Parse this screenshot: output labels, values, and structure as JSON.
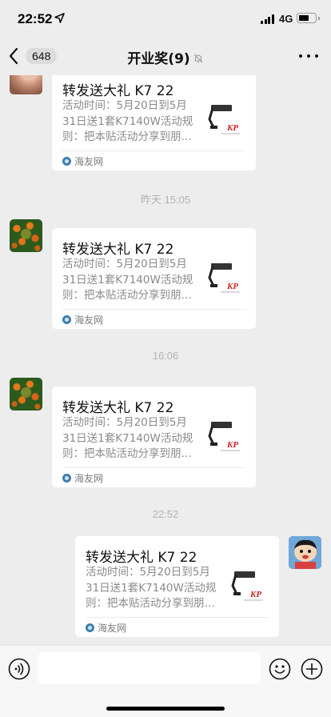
{
  "status_bar": {
    "time": "22:52",
    "network": "4G",
    "icons": [
      "location-arrow-icon",
      "signal-icon",
      "battery-icon"
    ]
  },
  "nav": {
    "unread_count": "648",
    "title": "开业奖(9)",
    "icons": [
      "back-chevron-icon",
      "mute-bell-icon",
      "more-icon"
    ]
  },
  "messages": {
    "timestamps": [
      "昨天 15:05",
      "16:06",
      "22:52"
    ],
    "cards": [
      {
        "sender": "other",
        "title": "转发送大礼 K7 22",
        "desc": "活动时间：5月20日到5月31日送1套K7140W活动规则：把本贴活动分享到朋友圈",
        "source": "海友网"
      },
      {
        "sender": "other",
        "title": "转发送大礼 K7 22",
        "desc": "活动时间：5月20日到5月31日送1套K7140W活动规则：把本贴活动分享到朋友圈",
        "source": "海友网"
      },
      {
        "sender": "other",
        "title": "转发送大礼 K7 22",
        "desc": "活动时间：5月20日到5月31日送1套K7140W活动规则：把本贴活动分享到朋友圈",
        "source": "海友网"
      },
      {
        "sender": "self",
        "title": "转发送大礼 K7 22",
        "desc": "活动时间：5月20日到5月31日送1套K7140W活动规则：把本贴活动分享到朋友圈",
        "source": "海友网"
      }
    ]
  },
  "input_bar": {
    "placeholder": "",
    "icons": [
      "voice-icon",
      "emoji-icon",
      "plus-icon"
    ]
  },
  "colors": {
    "background": "#ededed",
    "card": "#ffffff",
    "timestamp": "#b2b2b2"
  }
}
